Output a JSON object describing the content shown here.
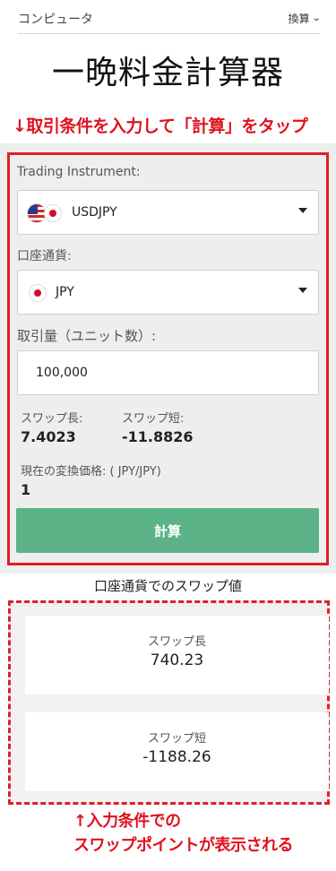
{
  "header": {
    "breadcrumb": "コンピュータ",
    "menu_label": "換算"
  },
  "page_title": "一晩料金計算器",
  "annotations": {
    "top_note": "↓取引条件を入力して「計算」をタップ",
    "bottom_note_line1": "↑入力条件での",
    "bottom_note_line2": "スワップポイントが表示される",
    "highlight_color": "#e01f26"
  },
  "form": {
    "instrument_label": "Trading Instrument:",
    "instrument_value": "USDJPY",
    "currency_label": "口座通貨:",
    "currency_value": "JPY",
    "amount_label": "取引量（ユニット数）:",
    "amount_value": "100,000",
    "swap_long_label": "スワップ長:",
    "swap_long_value": "7.4023",
    "swap_short_label": "スワップ短:",
    "swap_short_value": "-11.8826",
    "rate_label": "現在の変換価格: ( JPY/JPY)",
    "rate_value": "1",
    "calculate_label": "計算",
    "button_color": "#5cb388"
  },
  "results": {
    "title": "口座通貨でのスワップ値",
    "long_label": "スワップ長",
    "long_value": "740.23",
    "short_label": "スワップ短",
    "short_value": "-1188.26"
  },
  "icons": [
    "chevron-down-icon",
    "us-flag-icon",
    "jp-flag-icon",
    "dropdown-caret-icon"
  ]
}
